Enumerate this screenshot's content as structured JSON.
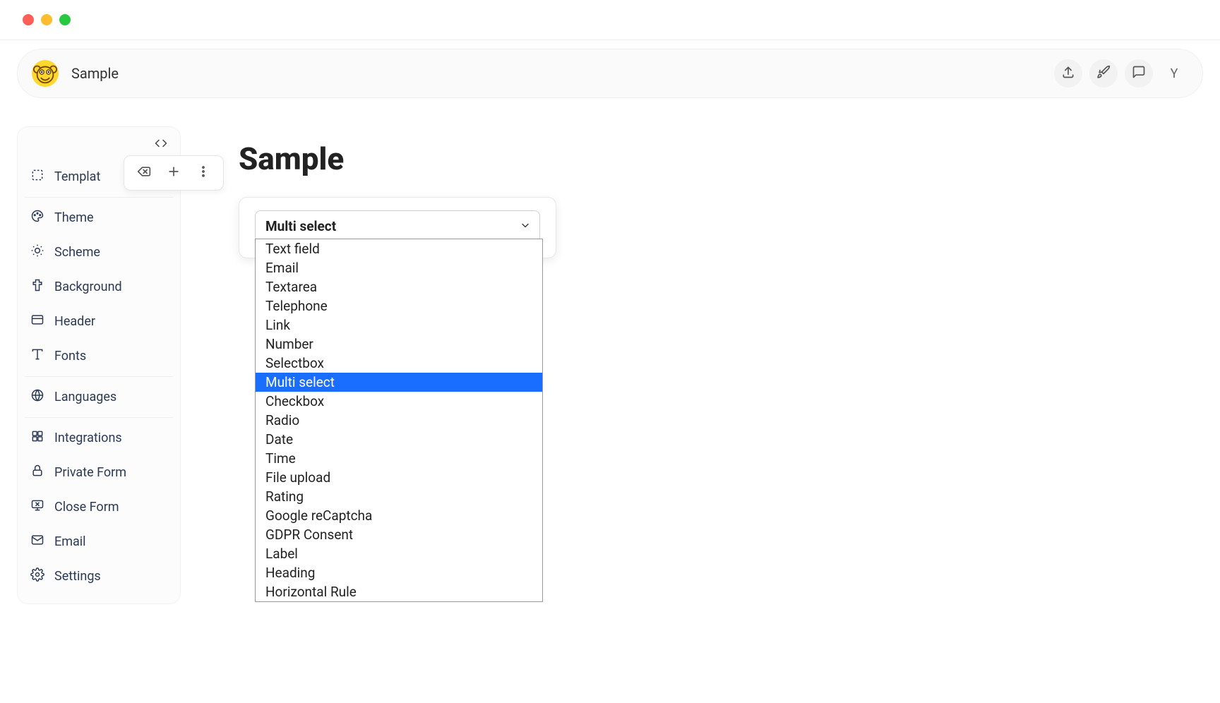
{
  "window": {
    "traffic": [
      "red",
      "yellow",
      "green"
    ]
  },
  "topbar": {
    "title": "Sample",
    "avatar_initial": "Y"
  },
  "sidebar": {
    "items": [
      {
        "icon": "template",
        "label": "Templat"
      },
      {
        "icon": "palette",
        "label": "Theme"
      },
      {
        "icon": "sun",
        "label": "Scheme"
      },
      {
        "icon": "brush",
        "label": "Background"
      },
      {
        "icon": "header",
        "label": "Header"
      },
      {
        "icon": "type",
        "label": "Fonts"
      },
      {
        "icon": "globe",
        "label": "Languages"
      },
      {
        "icon": "puzzle",
        "label": "Integrations"
      },
      {
        "icon": "lock",
        "label": "Private Form"
      },
      {
        "icon": "monitor-x",
        "label": "Close Form"
      },
      {
        "icon": "mail",
        "label": "Email"
      },
      {
        "icon": "settings",
        "label": "Settings"
      }
    ]
  },
  "page": {
    "title": "Sample"
  },
  "field_select": {
    "current": "Multi select",
    "options": [
      "Text field",
      "Email",
      "Textarea",
      "Telephone",
      "Link",
      "Number",
      "Selectbox",
      "Multi select",
      "Checkbox",
      "Radio",
      "Date",
      "Time",
      "File upload",
      "Rating",
      "Google reCaptcha",
      "GDPR Consent",
      "Label",
      "Heading",
      "Horizontal Rule"
    ],
    "selected_index": 7
  }
}
